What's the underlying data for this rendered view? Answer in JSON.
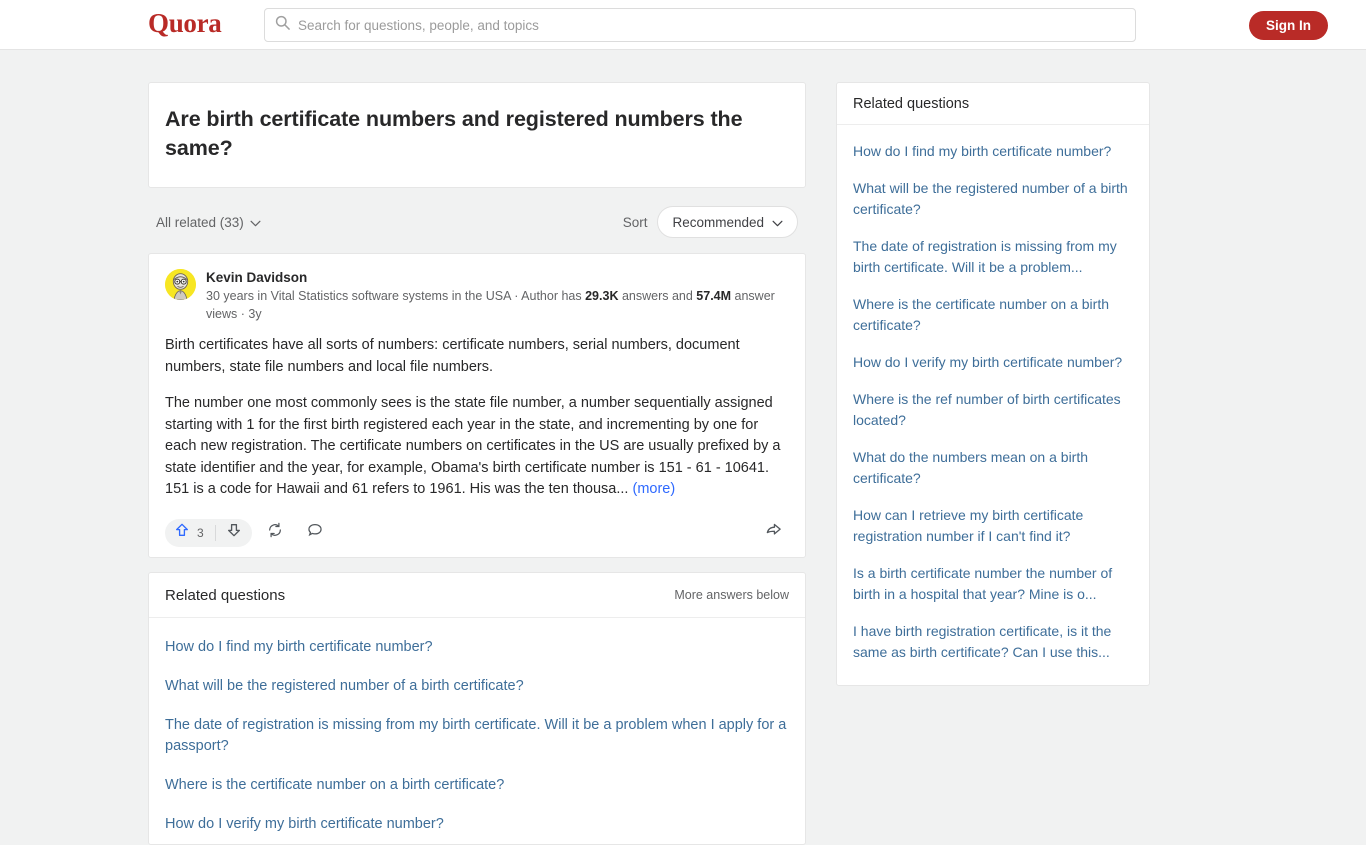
{
  "header": {
    "logo": "Quora",
    "search_placeholder": "Search for questions, people, and topics",
    "search_value": "",
    "search_icon": "search-icon",
    "signin_label": "Sign In"
  },
  "question": {
    "title": "Are birth certificate numbers and registered numbers the same?"
  },
  "filters": {
    "all_related_label": "All related (33)",
    "sort_label": "Sort",
    "sort_value": "Recommended"
  },
  "answer": {
    "author_name": "Kevin Davidson",
    "credential_prefix": "30 years in Vital Statistics software systems in the USA · Author has ",
    "answers_count": "29.3K",
    "credential_mid": " answers and ",
    "views_count": "57.4M",
    "credential_suffix": " answer views · 3y",
    "paragraph_1": "Birth certificates have all sorts of numbers: certificate numbers, serial numbers, document numbers, state file numbers and local file numbers.",
    "paragraph_2": "The number one most commonly sees is the state file number, a number sequentially assigned starting with 1 for the first birth registered each year in the state, and incrementing by one for each new registration. The certificate numbers on certificates in the US are usually prefixed by a state identifier and the year, for example, Obama's birth certificate number is 151 - 61 - 10641. 151 is a code for Hawaii and 61 refers to 1961. His was the ten thousa...",
    "more_label": "(more)",
    "upvote_count": "3",
    "upvote_icon": "upvote-arrow-icon",
    "downvote_icon": "downvote-arrow-icon",
    "repost_icon": "repost-icon",
    "comment_icon": "comment-bubble-icon",
    "share_icon": "share-arrow-icon"
  },
  "related_main": {
    "title": "Related questions",
    "more_answers_label": "More answers below",
    "items": [
      "How do I find my birth certificate number?",
      "What will be the registered number of a birth certificate?",
      "The date of registration is missing from my birth certificate. Will it be a problem when I apply for a passport?",
      "Where is the certificate number on a birth certificate?",
      "How do I verify my birth certificate number?"
    ]
  },
  "sidebar": {
    "title": "Related questions",
    "items": [
      "How do I find my birth certificate number?",
      "What will be the registered number of a birth certificate?",
      "The date of registration is missing from my birth certificate. Will it be a problem...",
      "Where is the certificate number on a birth certificate?",
      "How do I verify my birth certificate number?",
      "Where is the ref number of birth certificates located?",
      "What do the numbers mean on a birth certificate?",
      "How can I retrieve my birth certificate registration number if I can't find it?",
      "Is a birth certificate number the number of birth in a hospital that year? Mine is o...",
      "I have birth registration certificate, is it the same as birth certificate? Can I use this..."
    ]
  },
  "colors": {
    "brand_red": "#b92b27",
    "link_blue": "#3e6e99",
    "upvote_blue": "#2e69ff",
    "page_bg": "#f1f2f2",
    "avatar_bg": "#f7e623"
  }
}
